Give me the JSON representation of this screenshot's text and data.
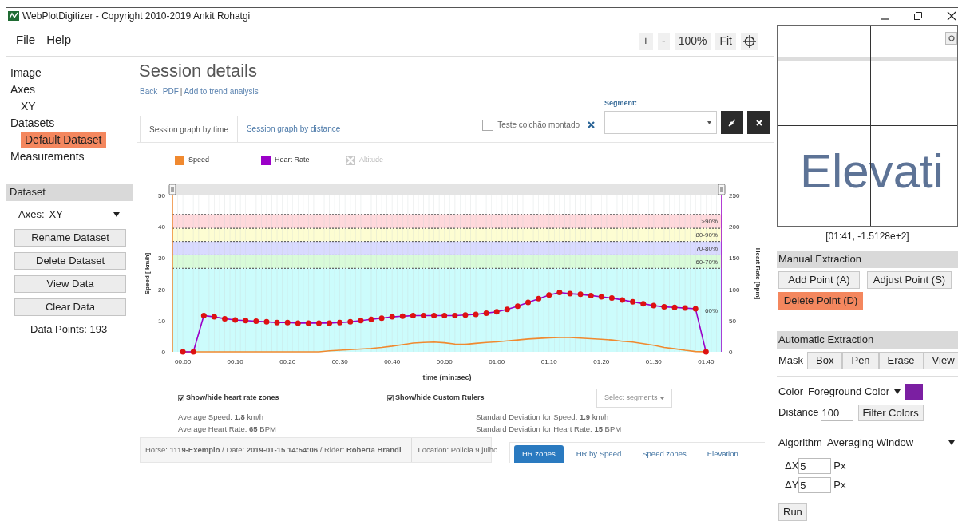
{
  "window": {
    "title": "WebPlotDigitizer - Copyright 2010-2019 Ankit Rohatgi"
  },
  "menu": [
    "File",
    "Help"
  ],
  "zoom_toolbar": [
    "+",
    "-",
    "100%",
    "Fit"
  ],
  "sidebar": {
    "tree": [
      {
        "label": "Image",
        "selected": false
      },
      {
        "label": "Axes",
        "selected": false,
        "children": [
          {
            "label": "XY",
            "selected": false
          }
        ]
      },
      {
        "label": "Datasets",
        "selected": false,
        "children": [
          {
            "label": "Default Dataset",
            "selected": true
          }
        ]
      },
      {
        "label": "Measurements",
        "selected": false
      }
    ],
    "dataset_panel": {
      "title": "Dataset",
      "axes_label": "Axes:",
      "axes_value": "XY",
      "buttons": [
        "Rename Dataset",
        "Delete Dataset",
        "View Data",
        "Clear Data"
      ],
      "data_points": "Data Points: 193"
    }
  },
  "page": {
    "title": "Session details",
    "links": [
      {
        "kind": "link",
        "text": "Back"
      },
      {
        "kind": "separator",
        "text": "|"
      },
      {
        "kind": "link",
        "text": "PDF"
      },
      {
        "kind": "separator",
        "text": "|"
      },
      {
        "kind": "link",
        "text": "Add to trend analysis"
      }
    ],
    "tabs": [
      {
        "label": "Session graph by time",
        "selected": true
      },
      {
        "label": "Session graph by distance",
        "selected": false
      }
    ],
    "filter": {
      "label": "Teste colchão montado",
      "checked": false
    },
    "segment": {
      "label": "Segment:"
    },
    "extra_legend": [
      {
        "label": "Altitude",
        "hidden": true
      }
    ],
    "chart_data": {
      "type": "line",
      "xlabel": "time (min:sec)",
      "ylabel": "Speed [ km/h]",
      "y2label": "Heart Rate [bpm]",
      "x": [
        0,
        2,
        4,
        6,
        8,
        10,
        12,
        14,
        16,
        18,
        20,
        22,
        24,
        26,
        28,
        30,
        32,
        34,
        36,
        38,
        40,
        42,
        44,
        46,
        48,
        50,
        52,
        54,
        56,
        58,
        60,
        62,
        64,
        66,
        68,
        70,
        72,
        74,
        76,
        78,
        80,
        82,
        84,
        86,
        88,
        90,
        92,
        94,
        96,
        98,
        100
      ],
      "series": [
        {
          "name": "Speed",
          "color": "#f0892f",
          "values": [
            0,
            0,
            0,
            0,
            0,
            0,
            0,
            0,
            0,
            0,
            0,
            0,
            0,
            0,
            0.3,
            0.5,
            0.7,
            0.9,
            1.1,
            1.4,
            1.8,
            2.3,
            2.8,
            3,
            3.1,
            2.9,
            2.5,
            2.4,
            2.7,
            3,
            3.2,
            3.5,
            3.8,
            4.1,
            4.3,
            4.5,
            4.6,
            4.6,
            4.4,
            4.2,
            4,
            3.8,
            3.4,
            3.1,
            2.6,
            2.1,
            1.4,
            1,
            0.5,
            0.1,
            0
          ]
        },
        {
          "name": "Heart Rate",
          "color": "#9b00c8",
          "axis": "y2",
          "marker": "circle",
          "values": [
            0,
            0,
            58,
            56,
            53,
            51,
            50,
            49,
            48,
            47,
            47,
            46,
            46,
            46,
            46,
            47,
            48,
            50,
            52,
            54,
            56,
            57,
            58,
            58,
            58,
            58,
            58,
            59,
            60,
            62,
            64,
            68,
            73,
            79,
            85,
            91,
            95,
            93,
            92,
            90,
            88,
            86,
            83,
            80,
            77,
            74,
            72,
            71,
            70,
            69,
            0
          ]
        }
      ],
      "xlim": [
        -2,
        103
      ],
      "ylim": [
        0,
        50
      ],
      "y2lim": [
        0,
        250
      ],
      "xticks": [
        {
          "value": 0,
          "label": "00:00"
        },
        {
          "value": 10,
          "label": "00:10"
        },
        {
          "value": 20,
          "label": "00:20"
        },
        {
          "value": 30,
          "label": "00:30"
        },
        {
          "value": 40,
          "label": "00:40"
        },
        {
          "value": 50,
          "label": "00:50"
        },
        {
          "value": 60,
          "label": "01:00"
        },
        {
          "value": 70,
          "label": "01:10"
        },
        {
          "value": 80,
          "label": "01:20"
        },
        {
          "value": 90,
          "label": "01:30"
        },
        {
          "value": 100,
          "label": "01:40"
        }
      ],
      "yticks": [
        0,
        10,
        20,
        30,
        40,
        50
      ],
      "y2ticks": [
        0,
        50,
        100,
        150,
        200,
        250
      ],
      "grid": true,
      "bands": [
        {
          "label": ">90%",
          "axis": "y",
          "from": 39.5,
          "to": 44,
          "color": "#ffd9dc"
        },
        {
          "label": "80-90%",
          "axis": "y",
          "from": 35.3,
          "to": 39.5,
          "color": "#fdfdd2"
        },
        {
          "label": "70-80%",
          "axis": "y",
          "from": 31,
          "to": 35.3,
          "color": "#d9daff"
        },
        {
          "label": "60-70%",
          "axis": "y",
          "from": 26.7,
          "to": 31,
          "color": "#d9fbd9"
        },
        {
          "label": "60%",
          "axis": "y",
          "from": 0,
          "to": 26.7,
          "color": "#ccfcfc"
        }
      ]
    },
    "toggles": [
      {
        "label": "Show/hide heart rate zones",
        "checked": true
      },
      {
        "label": "Show/hide Custom Rulers",
        "checked": true
      }
    ],
    "segments_button": "Select segments",
    "stats": [
      "Average Speed: **1.8** km/h",
      "Average Heart Rate: **65** BPM",
      "Standard Deviation for Speed: **1.9** km/h",
      "Standard Deviation for Heart Rate: **15** BPM"
    ],
    "info": "Horse: **1119-Exemplo** / Date: **2019-01-15 14:54:06** / Rider: **Roberta Brandi**",
    "location": "Location: Policia 9 julho",
    "bottom_tabs": [
      {
        "label": "HR zones",
        "selected": true
      },
      {
        "label": "HR by Speed",
        "selected": false
      },
      {
        "label": "Speed zones",
        "selected": false
      },
      {
        "label": "Elevation",
        "selected": false
      }
    ]
  },
  "right_panel": {
    "magnifier": {
      "text": "Elevati",
      "coords": "[01:41, -1.5128e+2]"
    },
    "manual": {
      "title": "Manual Extraction",
      "buttons": [
        {
          "label": "Add Point (A)",
          "selected": false
        },
        {
          "label": "Adjust Point (S)",
          "selected": false
        },
        {
          "label": "Delete Point (D)",
          "selected": true
        }
      ]
    },
    "automatic": {
      "title": "Automatic Extraction",
      "mask_label": "Mask",
      "mask_buttons": [
        {
          "label": "Box",
          "selected": false
        },
        {
          "label": "Pen",
          "selected": false
        },
        {
          "label": "Erase",
          "selected": false
        },
        {
          "label": "View",
          "selected": false
        }
      ],
      "color_label": "Color",
      "color_mode": "Foreground Color",
      "color": "#7b1fa2",
      "distance_label": "Distance",
      "distance": "100",
      "filter_button": "Filter Colors",
      "algorithm_label": "Algorithm",
      "algorithm": "Averaging Window",
      "params": [
        {
          "label": "ΔX",
          "value": "5",
          "unit": "Px"
        },
        {
          "label": "ΔY",
          "value": "5",
          "unit": "Px"
        }
      ],
      "run": "Run"
    }
  }
}
